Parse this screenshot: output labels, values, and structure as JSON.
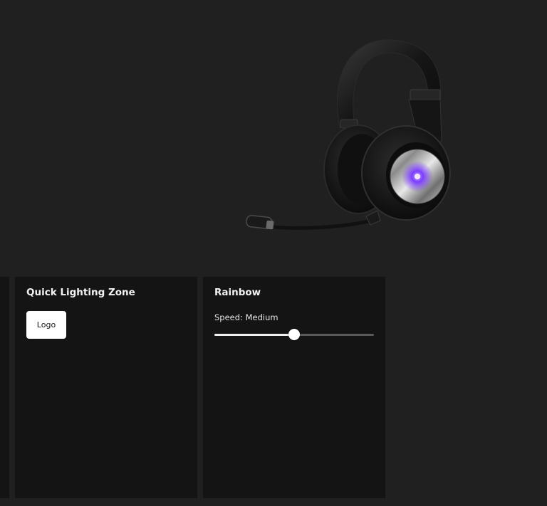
{
  "device": {
    "image_icon": "headset-icon",
    "led_color": "#7b3cff"
  },
  "zone_panel": {
    "title": "Quick Lighting Zone",
    "zones": [
      {
        "label": "Logo"
      }
    ]
  },
  "effect_panel": {
    "title": "Rainbow",
    "speed_label": "Speed: Medium",
    "speed_value": 0.5
  }
}
